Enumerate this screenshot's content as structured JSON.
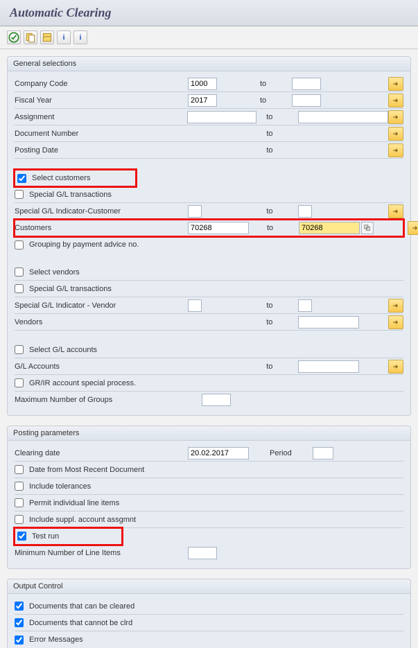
{
  "header": {
    "title": "Automatic Clearing"
  },
  "toolbar": {
    "icons": [
      "execute",
      "copy",
      "variant",
      "info",
      "info"
    ]
  },
  "groups": {
    "general": {
      "title": "General selections",
      "company_code_label": "Company Code",
      "company_code_from": "1000",
      "to_label": "to",
      "fiscal_year_label": "Fiscal Year",
      "fiscal_year_from": "2017",
      "assignment_label": "Assignment",
      "document_number_label": "Document Number",
      "posting_date_label": "Posting Date",
      "select_customers_label": "Select customers",
      "select_customers_checked": true,
      "sgl_trans_cust_label": "Special G/L transactions",
      "sgl_ind_cust_label": "Special G/L Indicator-Customer",
      "customers_label": "Customers",
      "customers_from": "70268",
      "customers_to": "70268",
      "grouping_label": "Grouping by payment advice no.",
      "select_vendors_label": "Select vendors",
      "sgl_trans_vend_label": "Special G/L transactions",
      "sgl_ind_vend_label": "Special G/L Indicator - Vendor",
      "vendors_label": "Vendors",
      "select_gl_label": "Select G/L accounts",
      "gl_accounts_label": "G/L Accounts",
      "grir_label": "GR/IR account special process.",
      "max_groups_label": "Maximum Number of Groups"
    },
    "posting": {
      "title": "Posting parameters",
      "clearing_date_label": "Clearing date",
      "clearing_date_value": "20.02.2017",
      "period_label": "Period",
      "date_most_recent_label": "Date from Most Recent Document",
      "include_tol_label": "Include tolerances",
      "permit_indiv_label": "Permit individual line items",
      "include_suppl_label": "Include suppl. account assgmnt",
      "test_run_label": "Test run",
      "test_run_checked": true,
      "min_line_items_label": "Minimum Number of Line Items"
    },
    "output": {
      "title": "Output Control",
      "doc_can_clear_label": "Documents that can be cleared",
      "doc_can_clear_checked": true,
      "doc_cannot_clear_label": "Documents that cannot be clrd",
      "doc_cannot_clear_checked": true,
      "error_msgs_label": "Error Messages",
      "error_msgs_checked": true
    }
  }
}
